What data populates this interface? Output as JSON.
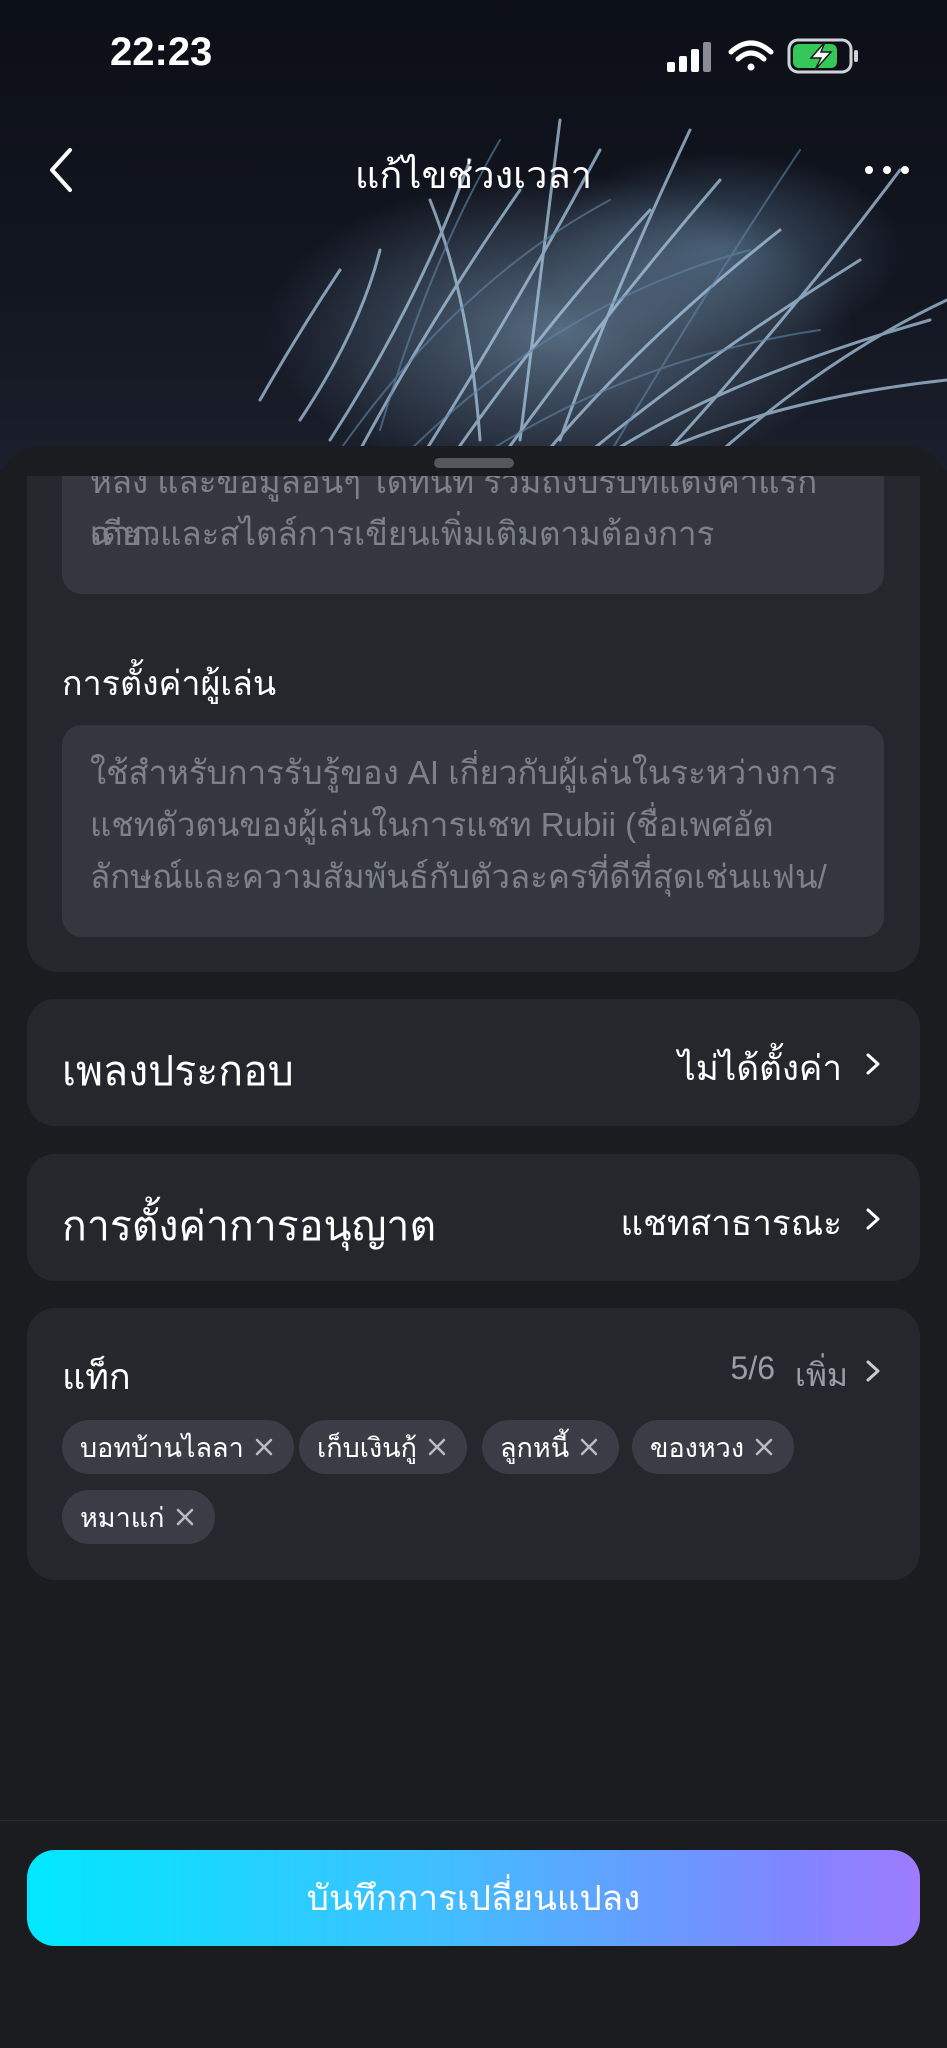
{
  "status_bar": {
    "time": "22:23",
    "signal_icon": "cellular-signal-icon",
    "wifi_icon": "wifi-icon",
    "battery_icon": "battery-charging-icon"
  },
  "nav": {
    "title": "แก้ไขช่วงเวลา",
    "back_icon": "chevron-left-icon",
    "more_icon": "more-dots-icon"
  },
  "form": {
    "description": {
      "line1": "หลัง และข้อมูลอื่นๆ ได้ทันที รวมถึงบริบทแต่งค่าแรกเดียว",
      "line2": "ฉาก และสไตล์การเขียนเพิ่มเติมตามต้องการ"
    },
    "player_settings": {
      "label": "การตั้งค่าผู้เล่น",
      "placeholder_line1": "ใช้สำหรับการรับรู้ของ AI เกี่ยวกับผู้เล่นในระหว่างการ",
      "placeholder_line2": "แชทตัวตนของผู้เล่นในการแชท Rubii (ชื่อเพศอัต",
      "placeholder_line3": "ลักษณ์และความสัมพันธ์กับตัวละครที่ดีที่สุดเช่นแฟน/"
    }
  },
  "music": {
    "label": "เพลงประกอบ",
    "value": "ไม่ได้ตั้งค่า"
  },
  "permission": {
    "label": "การตั้งค่าการอนุญาต",
    "value": "แชทสาธารณะ"
  },
  "tags": {
    "title": "แท็ก",
    "count": "5/6",
    "add_label": "เพิ่ม",
    "items": [
      "บอทบ้านไลลา",
      "เก็บเงินกู้",
      "ลูกหนี้",
      "ของหวง",
      "หมาแก่"
    ]
  },
  "save_button": {
    "label": "บันทึกการเปลี่ยนแปลง"
  },
  "colors": {
    "background": "#1b1c1f",
    "card": "#25272c",
    "input": "#34373e",
    "chip": "#3a3d45",
    "accent_start": "#00e8ff",
    "accent_end": "#9d7bff"
  }
}
